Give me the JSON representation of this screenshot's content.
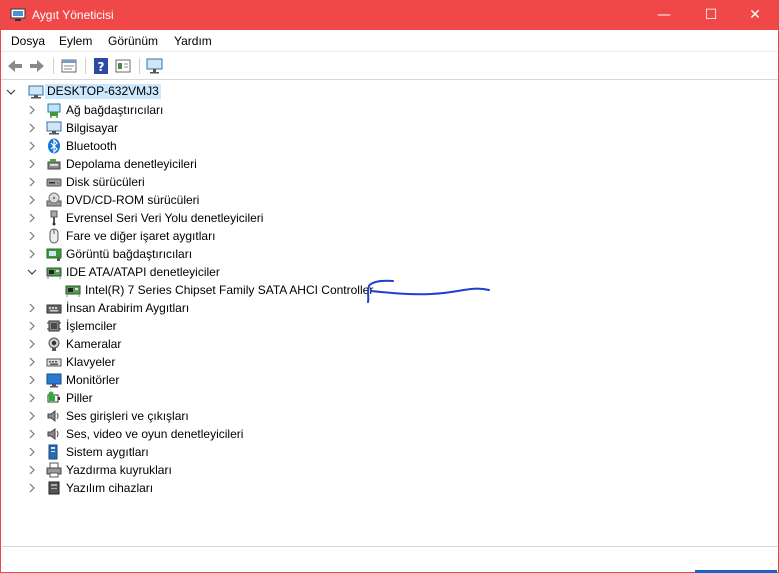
{
  "window": {
    "title": "Aygıt Yöneticisi",
    "controls": {
      "minimize": "—",
      "maximize": "☐",
      "close": "✕"
    }
  },
  "menu": [
    "Dosya",
    "Eylem",
    "Görünüm",
    "Yardım"
  ],
  "toolbar": {
    "buttons": [
      "back-arrow-icon",
      "forward-arrow-icon",
      "properties-icon",
      "help-icon",
      "update-driver-icon",
      "monitor-scan-icon"
    ]
  },
  "tree": {
    "root": {
      "label": "DESKTOP-632VMJ3",
      "expanded": true,
      "icon": "computer-icon"
    },
    "categories": [
      {
        "label": "Ağ bağdaştırıcıları",
        "icon": "network-adapter-icon",
        "expanded": false
      },
      {
        "label": "Bilgisayar",
        "icon": "computer-icon",
        "expanded": false
      },
      {
        "label": "Bluetooth",
        "icon": "bluetooth-icon",
        "expanded": false
      },
      {
        "label": "Depolama denetleyicileri",
        "icon": "storage-controller-icon",
        "expanded": false
      },
      {
        "label": "Disk sürücüleri",
        "icon": "disk-drive-icon",
        "expanded": false
      },
      {
        "label": "DVD/CD-ROM sürücüleri",
        "icon": "dvd-drive-icon",
        "expanded": false
      },
      {
        "label": "Evrensel Seri Veri Yolu denetleyicileri",
        "icon": "usb-icon",
        "expanded": false
      },
      {
        "label": "Fare ve diğer işaret aygıtları",
        "icon": "mouse-icon",
        "expanded": false
      },
      {
        "label": "Görüntü bağdaştırıcıları",
        "icon": "display-adapter-icon",
        "expanded": false
      },
      {
        "label": "IDE ATA/ATAPI denetleyiciler",
        "icon": "ide-controller-icon",
        "expanded": true,
        "children": [
          {
            "label": "Intel(R) 7 Series Chipset Family SATA AHCI Controller",
            "icon": "ide-controller-icon"
          }
        ]
      },
      {
        "label": "İnsan Arabirim Aygıtları",
        "icon": "hid-icon",
        "expanded": false
      },
      {
        "label": "İşlemciler",
        "icon": "processor-icon",
        "expanded": false
      },
      {
        "label": "Kameralar",
        "icon": "camera-icon",
        "expanded": false
      },
      {
        "label": "Klavyeler",
        "icon": "keyboard-icon",
        "expanded": false
      },
      {
        "label": "Monitörler",
        "icon": "monitor-icon",
        "expanded": false
      },
      {
        "label": "Piller",
        "icon": "battery-icon",
        "expanded": false
      },
      {
        "label": "Ses girişleri ve çıkışları",
        "icon": "speaker-icon",
        "expanded": false
      },
      {
        "label": "Ses, video ve oyun denetleyicileri",
        "icon": "speaker-icon",
        "expanded": false
      },
      {
        "label": "Sistem aygıtları",
        "icon": "system-device-icon",
        "expanded": false
      },
      {
        "label": "Yazdırma kuyrukları",
        "icon": "printer-icon",
        "expanded": false
      },
      {
        "label": "Yazılım cihazları",
        "icon": "software-device-icon",
        "expanded": false
      }
    ]
  },
  "colors": {
    "titlebar": "#f04848",
    "selection": "#cce8ff",
    "annotation": "#1f3fcf"
  }
}
